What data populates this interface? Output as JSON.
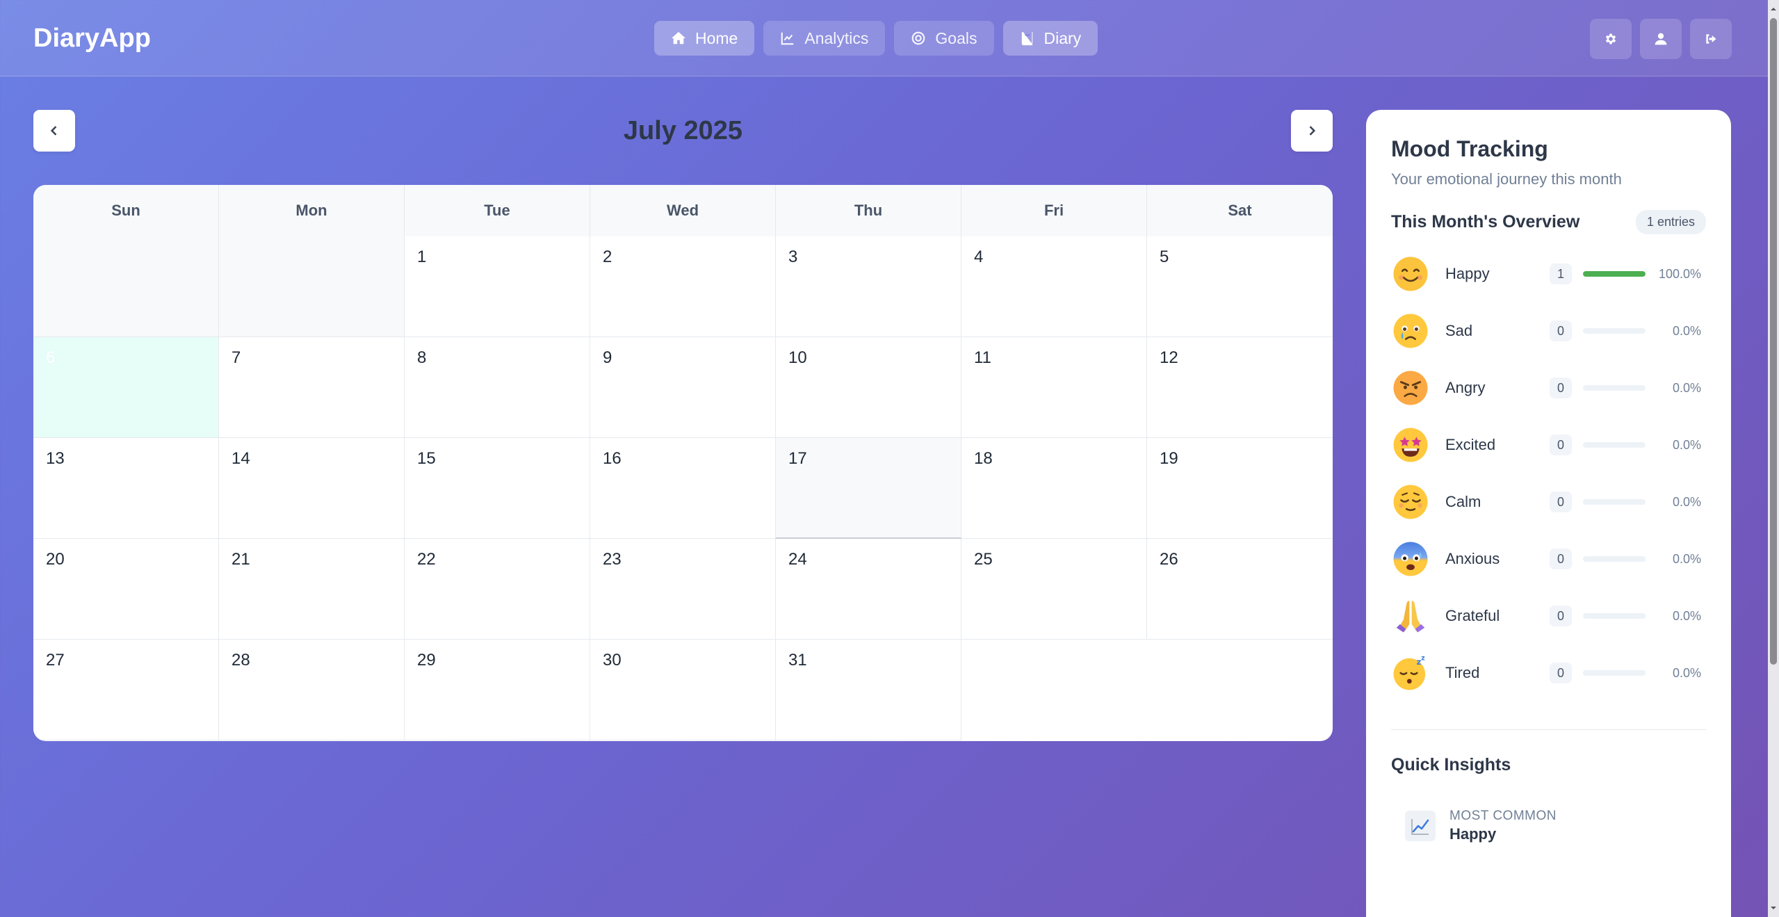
{
  "app": {
    "brand": "DiaryApp"
  },
  "nav": [
    {
      "label": "Home",
      "icon": "home-icon",
      "active": true
    },
    {
      "label": "Analytics",
      "icon": "chart-line-icon",
      "active": false
    },
    {
      "label": "Goals",
      "icon": "target-icon",
      "active": false
    },
    {
      "label": "Diary",
      "icon": "book-icon",
      "active": true
    }
  ],
  "header_actions": [
    "gear-icon",
    "user-icon",
    "sign-out-icon"
  ],
  "calendar": {
    "month_title": "July 2025",
    "weekdays": [
      "Sun",
      "Mon",
      "Tue",
      "Wed",
      "Thu",
      "Fri",
      "Sat"
    ],
    "days": [
      "1",
      "2",
      "3",
      "4",
      "5",
      "6",
      "7",
      "8",
      "9",
      "10",
      "11",
      "12",
      "13",
      "14",
      "15",
      "16",
      "17",
      "18",
      "19",
      "20",
      "21",
      "22",
      "23",
      "24",
      "25",
      "26",
      "27",
      "28",
      "29",
      "30",
      "31"
    ],
    "today": "6",
    "hovered": "17"
  },
  "mood_panel": {
    "title": "Mood Tracking",
    "subtitle": "Your emotional journey this month",
    "overview_title": "This Month's Overview",
    "entries_badge": "1 entries",
    "moods": [
      {
        "name": "Happy",
        "count": "1",
        "percent": "100.0%",
        "fill": 1.0,
        "icon": "smiling-face-icon"
      },
      {
        "name": "Sad",
        "count": "0",
        "percent": "0.0%",
        "fill": 0,
        "icon": "crying-face-icon"
      },
      {
        "name": "Angry",
        "count": "0",
        "percent": "0.0%",
        "fill": 0,
        "icon": "angry-face-icon"
      },
      {
        "name": "Excited",
        "count": "0",
        "percent": "0.0%",
        "fill": 0,
        "icon": "star-struck-face-icon"
      },
      {
        "name": "Calm",
        "count": "0",
        "percent": "0.0%",
        "fill": 0,
        "icon": "relieved-face-icon"
      },
      {
        "name": "Anxious",
        "count": "0",
        "percent": "0.0%",
        "fill": 0,
        "icon": "anxious-face-icon"
      },
      {
        "name": "Grateful",
        "count": "0",
        "percent": "0.0%",
        "fill": 0,
        "icon": "folded-hands-icon"
      },
      {
        "name": "Tired",
        "count": "0",
        "percent": "0.0%",
        "fill": 0,
        "icon": "sleeping-face-icon"
      }
    ],
    "insights_title": "Quick Insights",
    "insight": {
      "label": "Most Common",
      "value": "Happy",
      "icon": "chart-increasing-icon"
    }
  },
  "colors": {
    "accent_green": "#4caf50",
    "today_highlight": "#e6fdf8",
    "background_start": "#6a7fe4",
    "background_end": "#7453b4"
  }
}
